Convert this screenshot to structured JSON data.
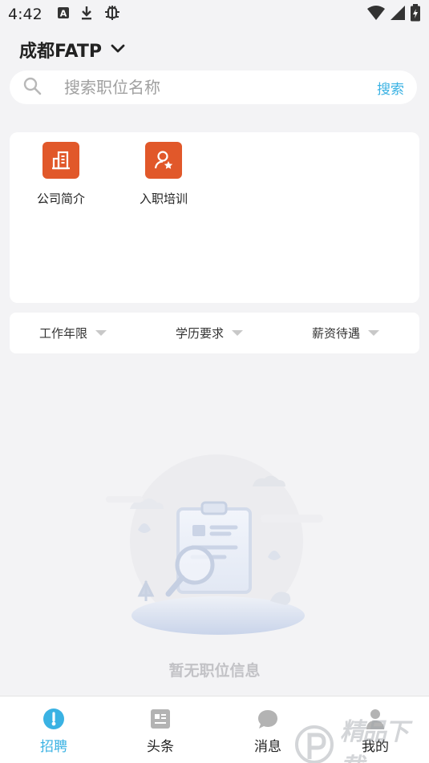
{
  "status_bar": {
    "time": "4:42",
    "icons": [
      "font-a-icon",
      "download-icon",
      "bug-icon",
      "wifi-icon",
      "signal-icon",
      "battery-charging-icon"
    ]
  },
  "header": {
    "city": "成都FATP",
    "city_icon": "chevron-down-icon"
  },
  "search": {
    "placeholder": "搜索职位名称",
    "value": "",
    "button_label": "搜索"
  },
  "shortcuts": [
    {
      "label": "公司简介",
      "icon": "company-building-icon"
    },
    {
      "label": "入职培训",
      "icon": "user-star-icon"
    }
  ],
  "filters": [
    {
      "label": "工作年限"
    },
    {
      "label": "学历要求"
    },
    {
      "label": "薪资待遇"
    }
  ],
  "empty_state": {
    "message": "暂无职位信息",
    "icon": "empty-clipboard-search-icon"
  },
  "tab_bar": {
    "tabs": [
      {
        "label": "招聘",
        "icon": "recruit-icon",
        "active": true
      },
      {
        "label": "头条",
        "icon": "news-icon",
        "active": false
      },
      {
        "label": "消息",
        "icon": "message-bubble-icon",
        "active": false
      },
      {
        "label": "我的",
        "icon": "user-icon",
        "active": false
      }
    ]
  },
  "watermark": {
    "logo_text": "精品下载"
  },
  "colors": {
    "accent": "#3ab2e3",
    "shortcut_bg": "#e1582a",
    "background": "#f3f3f5",
    "empty_text": "#c2c2c6"
  }
}
